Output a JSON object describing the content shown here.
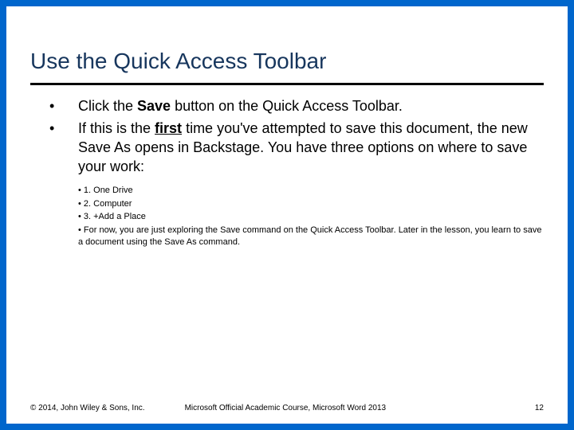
{
  "title": "Use the Quick Access Toolbar",
  "bullets": {
    "b1_pre": "Click the ",
    "b1_bold": "Save",
    "b1_post": " button on the Quick Access Toolbar.",
    "b2_pre": "If this is the ",
    "b2_emph": "first",
    "b2_post": " time you've attempted to save this document, the new Save As opens in Backstage. You have three options on where to save your work:"
  },
  "sub": {
    "s1": "• 1.  One Drive",
    "s2": "• 2.  Computer",
    "s3": "• 3.  +Add a Place",
    "s4": "• For now, you are just exploring the Save command on the Quick Access Toolbar. Later in the lesson, you learn to save a document using the Save As command."
  },
  "footer": {
    "copyright": "© 2014, John Wiley & Sons, Inc.",
    "course": "Microsoft Official Academic Course, Microsoft Word 2013",
    "page": "12"
  },
  "dot": "•"
}
